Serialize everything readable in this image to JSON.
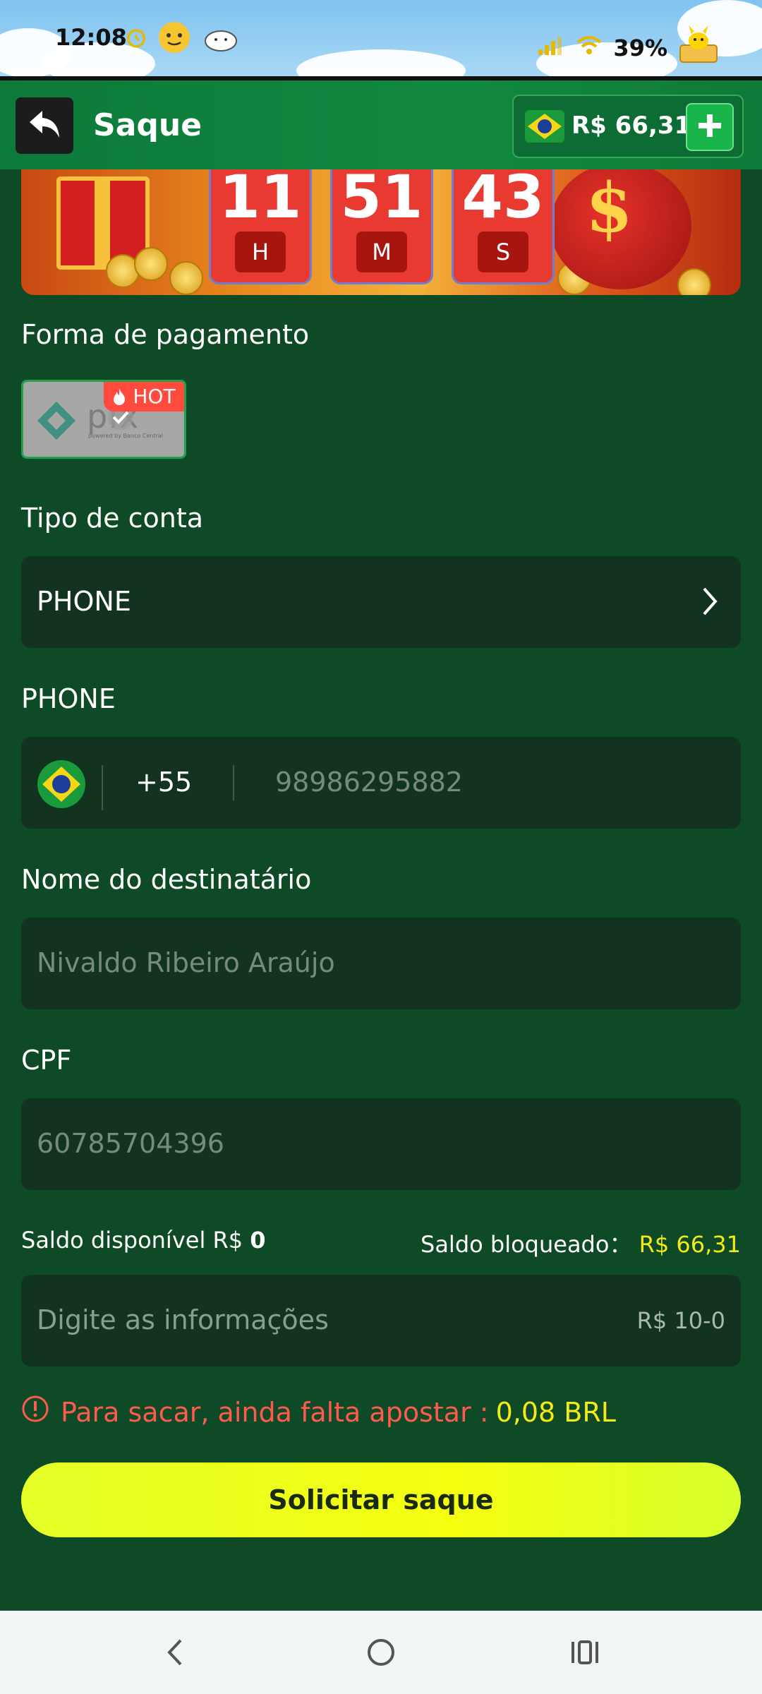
{
  "status_bar": {
    "time": "12:08",
    "battery": "39%"
  },
  "header": {
    "title": "Saque",
    "balance": "R$ 66,31"
  },
  "banner": {
    "hours": "11",
    "hours_unit": "H",
    "minutes": "51",
    "minutes_unit": "M",
    "seconds": "43",
    "seconds_unit": "S"
  },
  "payment": {
    "label": "Forma de pagamento",
    "method_name": "pix",
    "method_sub": "powered by Banco Central",
    "hot_badge": "HOT"
  },
  "account_type": {
    "label": "Tipo de conta",
    "value": "PHONE"
  },
  "phone": {
    "label": "PHONE",
    "country_code": "+55",
    "placeholder": "98986295882"
  },
  "recipient": {
    "label": "Nome do destinatário",
    "placeholder": "Nivaldo Ribeiro Araújo"
  },
  "cpf": {
    "label": "CPF",
    "placeholder": "60785704396"
  },
  "saldo": {
    "available_label": "Saldo disponível R$",
    "available_value": "0",
    "blocked_label": "Saldo bloqueado：",
    "blocked_value": "R$ 66,31"
  },
  "amount": {
    "placeholder": "Digite as informações",
    "range": "R$ 10-0"
  },
  "warning": {
    "text": "Para sacar, ainda falta apostar :",
    "value": "0,08 BRL"
  },
  "submit_label": "Solicitar saque",
  "colors": {
    "background": "#0e4a26",
    "header": "#0d7a3a",
    "field": "#12331f",
    "accent_yellow": "#f6ea16",
    "warning_red": "#ff5a4e",
    "button": "#f4ff10"
  }
}
